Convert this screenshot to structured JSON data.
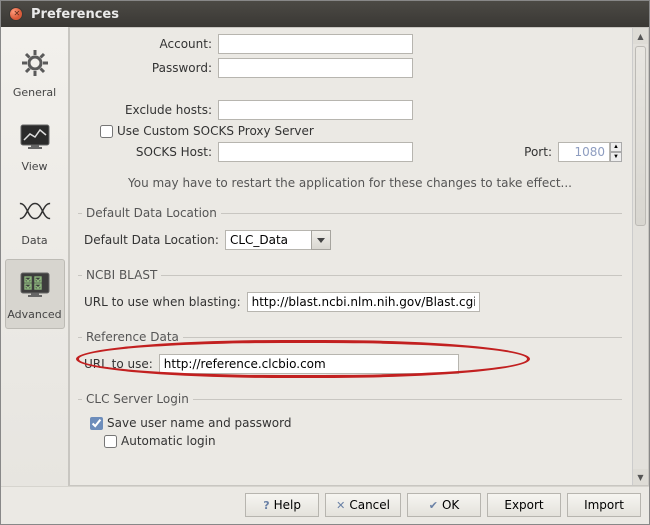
{
  "titlebar": {
    "title": "Preferences"
  },
  "sidebar": {
    "items": [
      {
        "label": "General"
      },
      {
        "label": "View"
      },
      {
        "label": "Data"
      },
      {
        "label": "Advanced"
      }
    ]
  },
  "form": {
    "account_label": "Account:",
    "account_value": "",
    "password_label": "Password:",
    "password_value": "",
    "exclude_hosts_label": "Exclude hosts:",
    "exclude_hosts_value": "",
    "use_custom_socks_label": "Use Custom SOCKS Proxy Server",
    "use_custom_socks_checked": false,
    "socks_host_label": "SOCKS Host:",
    "socks_host_value": "",
    "port_label": "Port:",
    "port_value": "1080",
    "restart_note": "You may have to restart the application for these changes to take effect..."
  },
  "groups": {
    "default_data_location": {
      "legend": "Default Data Location",
      "label": "Default Data Location:",
      "value": "CLC_Data"
    },
    "ncbi_blast": {
      "legend": "NCBI BLAST",
      "label": "URL to use when blasting:",
      "value": "http://blast.ncbi.nlm.nih.gov/Blast.cgi"
    },
    "reference_data": {
      "legend": "Reference Data",
      "label": "URL to use:",
      "value": "http://reference.clcbio.com"
    },
    "clc_server_login": {
      "legend": "CLC Server Login",
      "save_label": "Save user name and password",
      "save_checked": true,
      "auto_label": "Automatic login",
      "auto_checked": false
    }
  },
  "buttons": {
    "help": "Help",
    "cancel": "Cancel",
    "ok": "OK",
    "export": "Export",
    "import": "Import"
  }
}
